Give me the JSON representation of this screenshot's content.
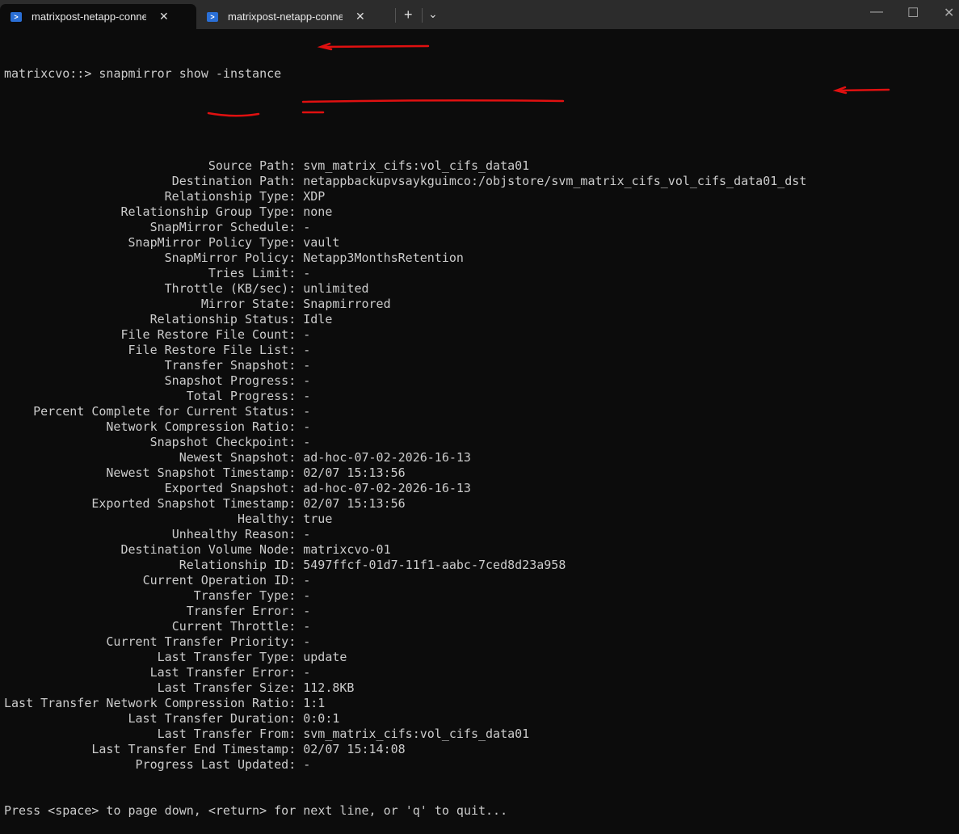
{
  "tabs": [
    {
      "title": "matrixpost-netapp-connector",
      "active": true
    },
    {
      "title": "matrixpost-netapp-connector(",
      "active": false
    }
  ],
  "tab_controls": {
    "new_tab": "+",
    "dropdown": "⌄"
  },
  "window_controls": {
    "minimize": "—",
    "maximize": "☐",
    "close": "✕"
  },
  "prompt": "matrixcvo::> snapmirror show -instance",
  "fields": [
    {
      "key": "Source Path",
      "value": "svm_matrix_cifs:vol_cifs_data01"
    },
    {
      "key": "Destination Path",
      "value": "netappbackupvsaykguimco:/objstore/svm_matrix_cifs_vol_cifs_data01_dst"
    },
    {
      "key": "Relationship Type",
      "value": "XDP"
    },
    {
      "key": "Relationship Group Type",
      "value": "none"
    },
    {
      "key": "SnapMirror Schedule",
      "value": "-"
    },
    {
      "key": "SnapMirror Policy Type",
      "value": "vault"
    },
    {
      "key": "SnapMirror Policy",
      "value": "Netapp3MonthsRetention"
    },
    {
      "key": "Tries Limit",
      "value": "-"
    },
    {
      "key": "Throttle (KB/sec)",
      "value": "unlimited"
    },
    {
      "key": "Mirror State",
      "value": "Snapmirrored"
    },
    {
      "key": "Relationship Status",
      "value": "Idle"
    },
    {
      "key": "File Restore File Count",
      "value": "-"
    },
    {
      "key": "File Restore File List",
      "value": "-"
    },
    {
      "key": "Transfer Snapshot",
      "value": "-"
    },
    {
      "key": "Snapshot Progress",
      "value": "-"
    },
    {
      "key": "Total Progress",
      "value": "-"
    },
    {
      "key": "Percent Complete for Current Status",
      "value": "-"
    },
    {
      "key": "Network Compression Ratio",
      "value": "-"
    },
    {
      "key": "Snapshot Checkpoint",
      "value": "-"
    },
    {
      "key": "Newest Snapshot",
      "value": "ad-hoc-07-02-2026-16-13"
    },
    {
      "key": "Newest Snapshot Timestamp",
      "value": "02/07 15:13:56"
    },
    {
      "key": "Exported Snapshot",
      "value": "ad-hoc-07-02-2026-16-13"
    },
    {
      "key": "Exported Snapshot Timestamp",
      "value": "02/07 15:13:56"
    },
    {
      "key": "Healthy",
      "value": "true"
    },
    {
      "key": "Unhealthy Reason",
      "value": "-"
    },
    {
      "key": "Destination Volume Node",
      "value": "matrixcvo-01"
    },
    {
      "key": "Relationship ID",
      "value": "5497ffcf-01d7-11f1-aabc-7ced8d23a958"
    },
    {
      "key": "Current Operation ID",
      "value": "-"
    },
    {
      "key": "Transfer Type",
      "value": "-"
    },
    {
      "key": "Transfer Error",
      "value": "-"
    },
    {
      "key": "Current Throttle",
      "value": "-"
    },
    {
      "key": "Current Transfer Priority",
      "value": "-"
    },
    {
      "key": "Last Transfer Type",
      "value": "update"
    },
    {
      "key": "Last Transfer Error",
      "value": "-"
    },
    {
      "key": "Last Transfer Size",
      "value": "112.8KB"
    },
    {
      "key": "Last Transfer Network Compression Ratio",
      "value": "1:1"
    },
    {
      "key": "Last Transfer Duration",
      "value": "0:0:1"
    },
    {
      "key": "Last Transfer From",
      "value": "svm_matrix_cifs:vol_cifs_data01"
    },
    {
      "key": "Last Transfer End Timestamp",
      "value": "02/07 15:14:08"
    },
    {
      "key": "Progress Last Updated",
      "value": "-"
    }
  ],
  "pager": "Press <space> to page down, <return> for next line, or 'q' to quit...",
  "colors": {
    "background": "#0c0c0c",
    "text": "#cccccc",
    "annotation": "#e01010",
    "tabbar": "#2c2c2c"
  }
}
